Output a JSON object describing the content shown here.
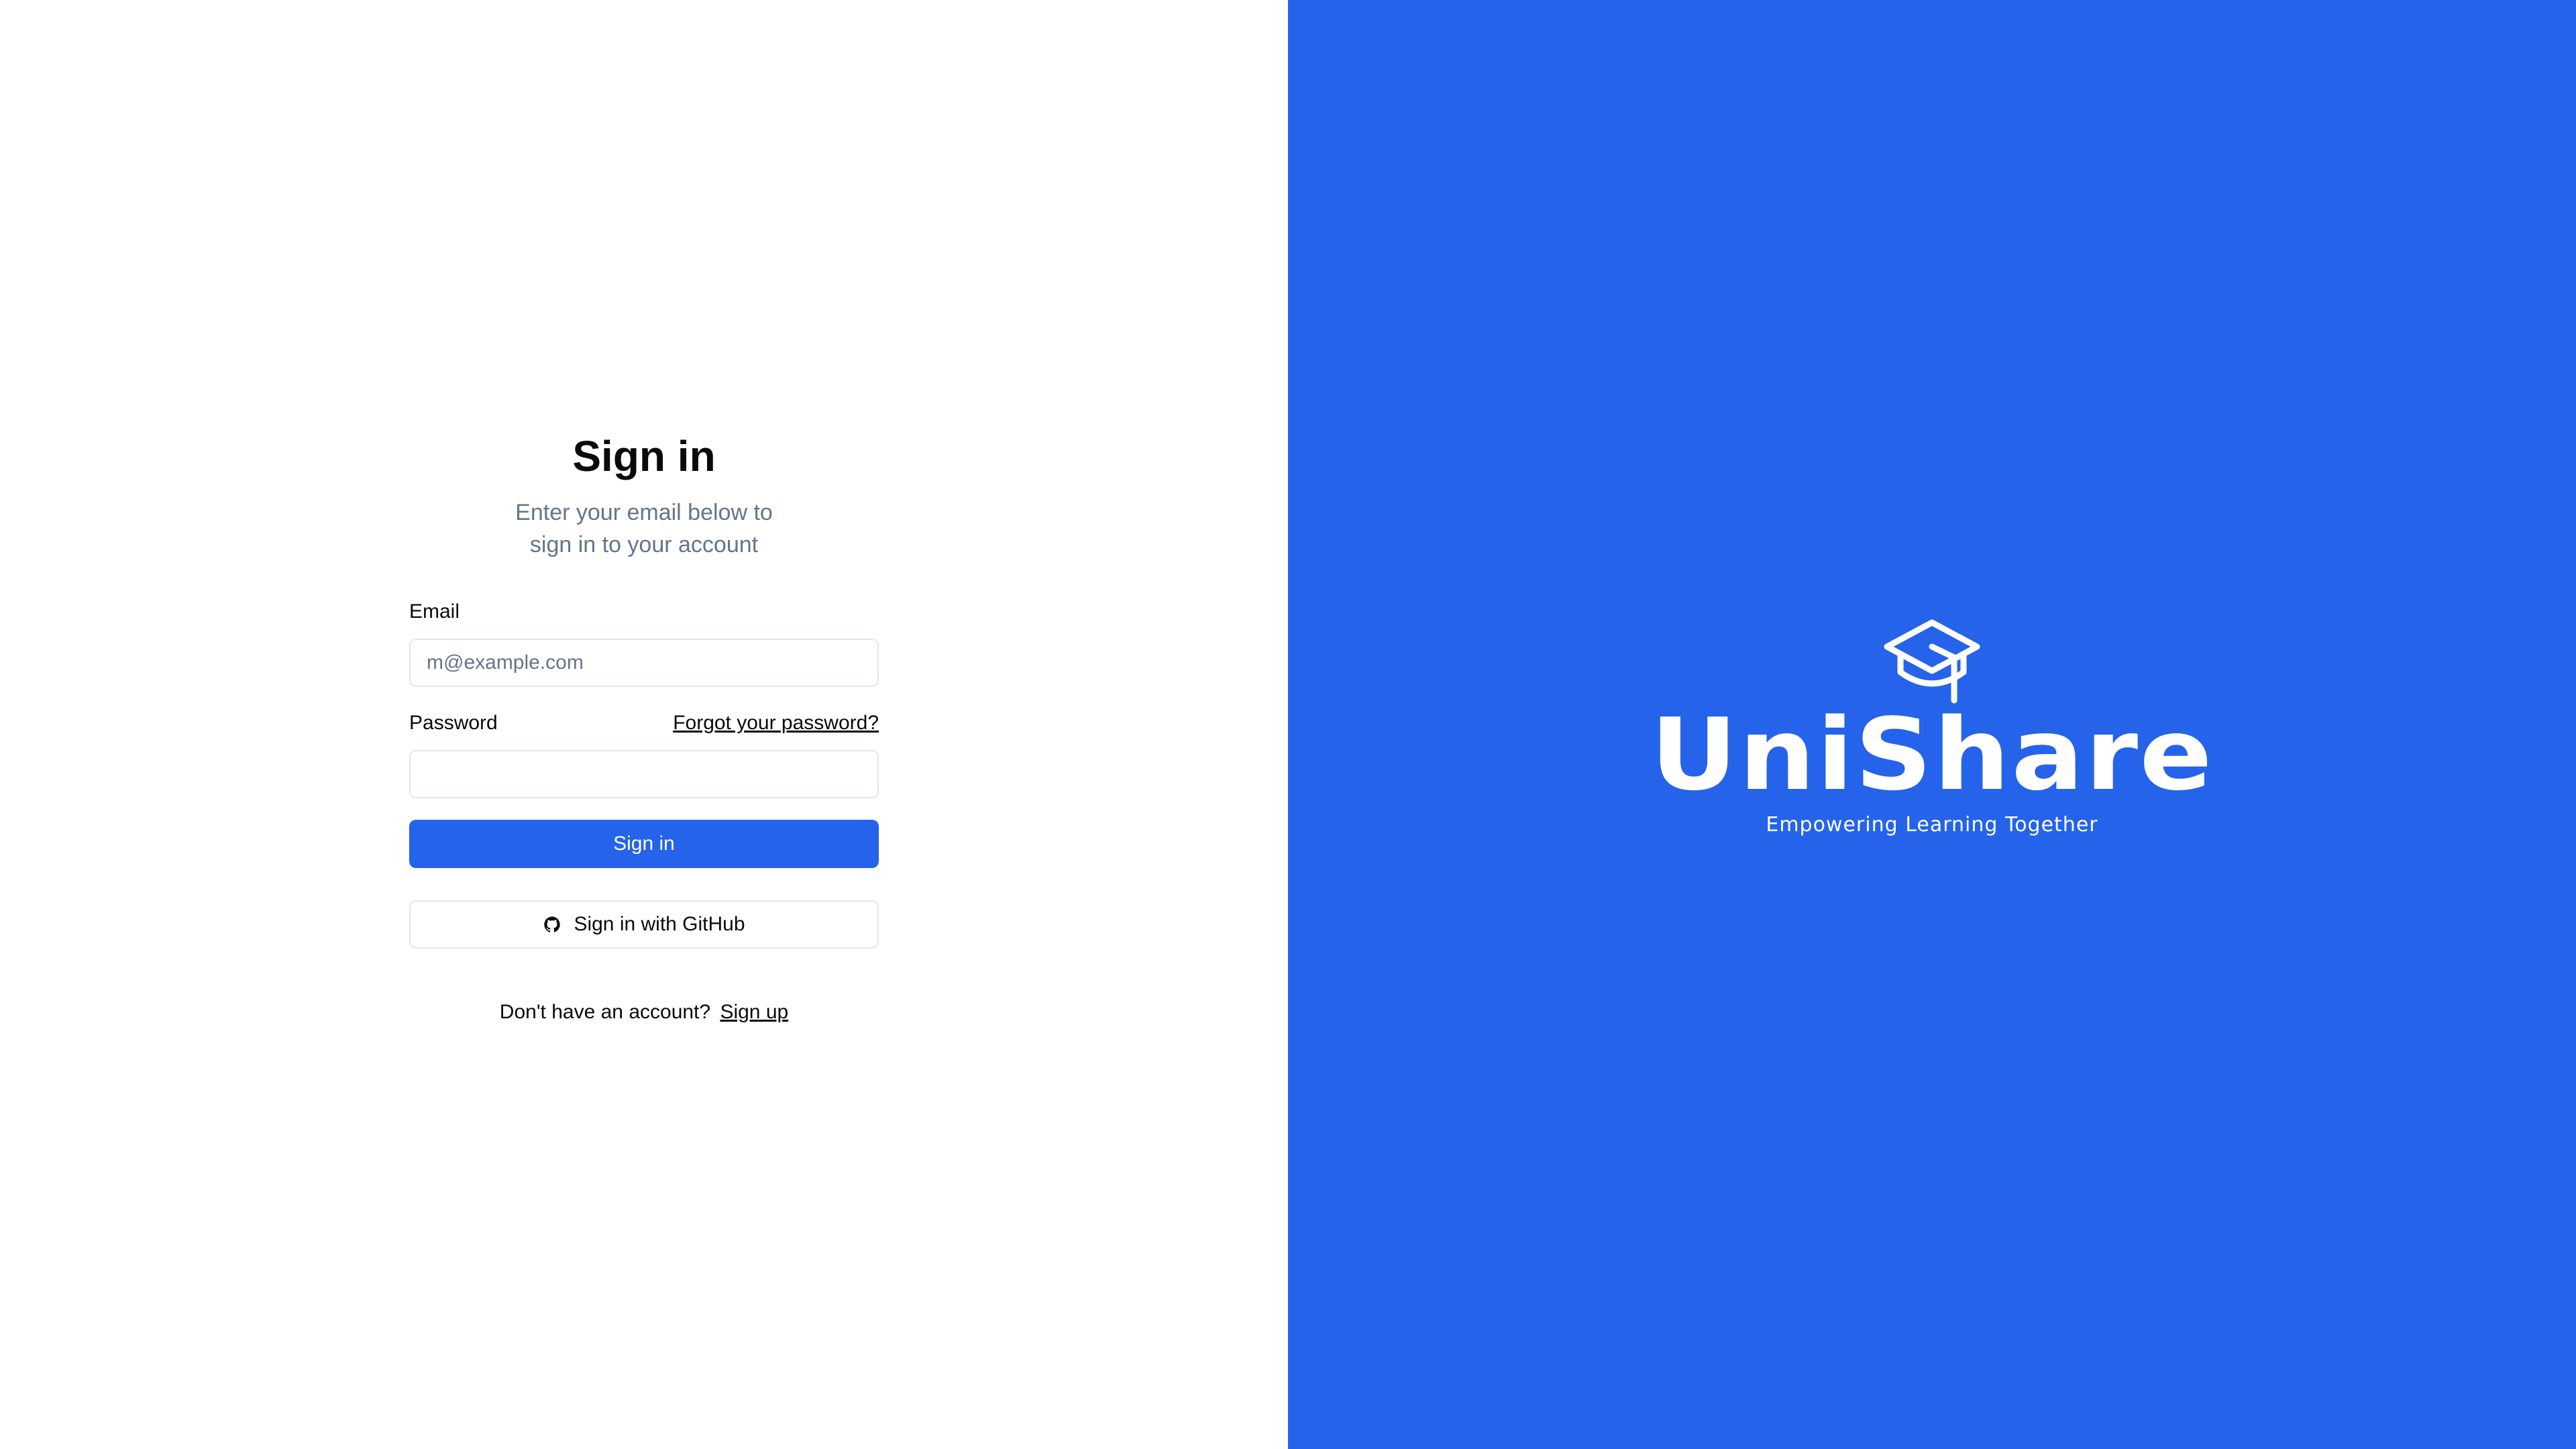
{
  "signin": {
    "title": "Sign in",
    "subtitle": "Enter your email below to sign in to your account",
    "email_label": "Email",
    "email_placeholder": "m@example.com",
    "email_value": "",
    "password_label": "Password",
    "forgot_link": "Forgot your password?",
    "password_value": "",
    "submit_label": "Sign in",
    "github_label": "Sign in with GitHub",
    "signup_prompt": "Don't have an account?",
    "signup_link": "Sign up"
  },
  "brand": {
    "name": "UniShare",
    "tagline": "Empowering Learning Together",
    "icon": "graduation-cap-icon",
    "background_color": "#2563eb"
  },
  "colors": {
    "primary": "#2563eb",
    "text": "#0a0a0a",
    "muted": "#64748b",
    "border": "#e2e8f0"
  }
}
